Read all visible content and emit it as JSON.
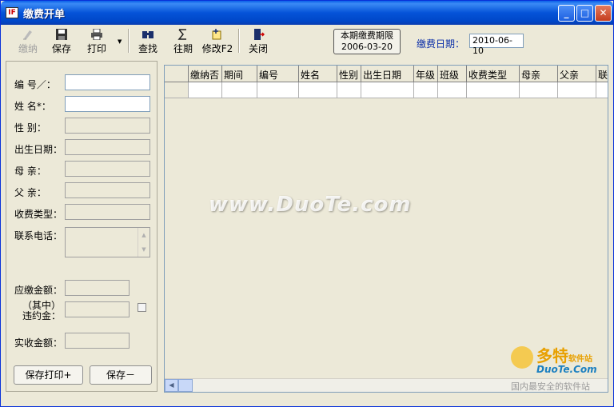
{
  "window": {
    "title": "缴费开单",
    "app_icon": "IF",
    "controls": {
      "minimize": "_",
      "maximize": "□",
      "close": "✕"
    }
  },
  "toolbar": {
    "pay": "缴纳",
    "save": "保存",
    "print": "打印",
    "find": "查找",
    "past": "往期",
    "modify": "修改F2",
    "close": "关闭",
    "deadline_title": "本期缴费期限",
    "deadline_date": "2006-03-20",
    "pay_date_label": "缴费日期：",
    "pay_date_value": "2010-06-10"
  },
  "form": {
    "id_label": "编  号／：",
    "name_label": "姓  名*：",
    "gender_label": "性  别：",
    "birth_label": "出生日期：",
    "mother_label": "母  亲：",
    "father_label": "父  亲：",
    "fee_type_label": "收费类型：",
    "phone_label": "联系电话：",
    "due_label": "应缴金额：",
    "penalty_label_1": "（其中）",
    "penalty_label_2": "违约金：",
    "received_label": "实收金额：",
    "save_print_button": "保存打印+",
    "save_button": "保存－"
  },
  "grid": {
    "columns": [
      "缴纳否",
      "期间",
      "编号",
      "姓名",
      "性别",
      "出生日期",
      "年级",
      "班级",
      "收费类型",
      "母亲",
      "父亲",
      "联"
    ]
  },
  "watermark": {
    "main": "www.DuoTe.com",
    "logo_cn": "多特",
    "logo_small": "软件站",
    "logo_en": "DuoTe.Com",
    "logo_tagline": "国内最安全的软件站"
  }
}
